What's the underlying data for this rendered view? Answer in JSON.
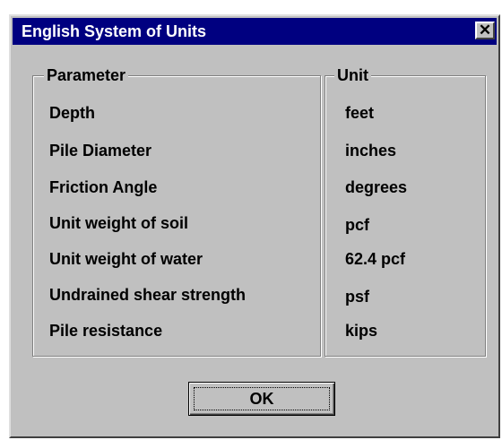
{
  "window": {
    "title": "English System of Units",
    "close_glyph": "✕"
  },
  "parameter_group": {
    "legend": "Parameter",
    "items": [
      "Depth",
      "Pile Diameter",
      "Friction Angle",
      "Unit weight of soil",
      "Unit weight of water",
      "Undrained shear strength",
      "Pile resistance"
    ]
  },
  "unit_group": {
    "legend": "Unit",
    "items": [
      "feet",
      "inches",
      "degrees",
      "pcf",
      "62.4 pcf",
      "psf",
      "kips"
    ]
  },
  "ok_button": {
    "label": "OK"
  },
  "colors": {
    "titlebar": "#000080",
    "face": "#c0c0c0"
  }
}
